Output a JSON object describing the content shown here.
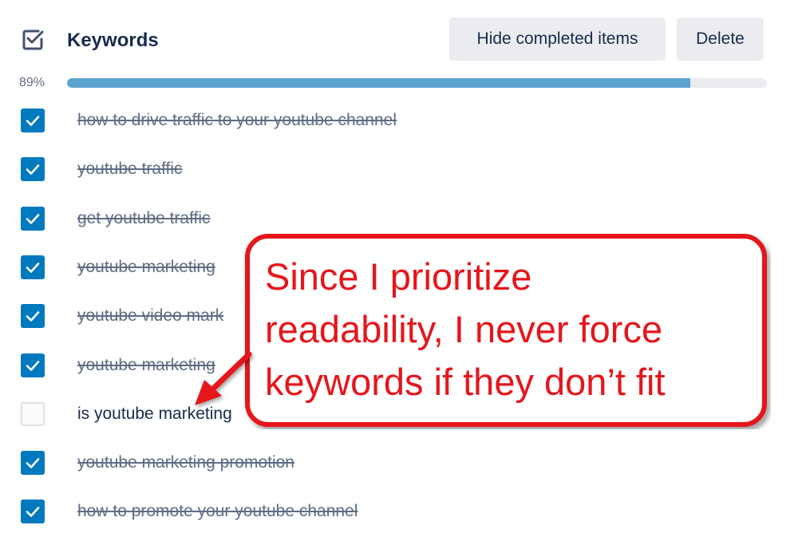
{
  "header": {
    "title": "Keywords",
    "icon": "checklist-icon",
    "hide_completed_label": "Hide completed items",
    "delete_label": "Delete"
  },
  "progress": {
    "label": "89%",
    "value": 89
  },
  "items": [
    {
      "text": "how to drive traffic to your youtube channel",
      "checked": true
    },
    {
      "text": "youtube traffic",
      "checked": true
    },
    {
      "text": "get youtube traffic",
      "checked": true
    },
    {
      "text": "youtube marketing",
      "checked": true
    },
    {
      "text": "youtube video mark",
      "checked": true
    },
    {
      "text": "youtube marketing",
      "checked": true
    },
    {
      "text": "is youtube marketing",
      "checked": false
    },
    {
      "text": "youtube marketing promotion",
      "checked": true
    },
    {
      "text": "how to promote your youtube channel",
      "checked": true
    }
  ],
  "callout": {
    "lines": [
      "Since I prioritize",
      "readability, I never force",
      "keywords if they don’t fit"
    ],
    "color": "#e5161b"
  },
  "colors": {
    "checkbox_checked": "#0079bf",
    "progress_fill": "#5ba4cf",
    "progress_track": "#ebecf0",
    "button_bg": "#ebecf0",
    "callout_red": "#e5161b"
  }
}
